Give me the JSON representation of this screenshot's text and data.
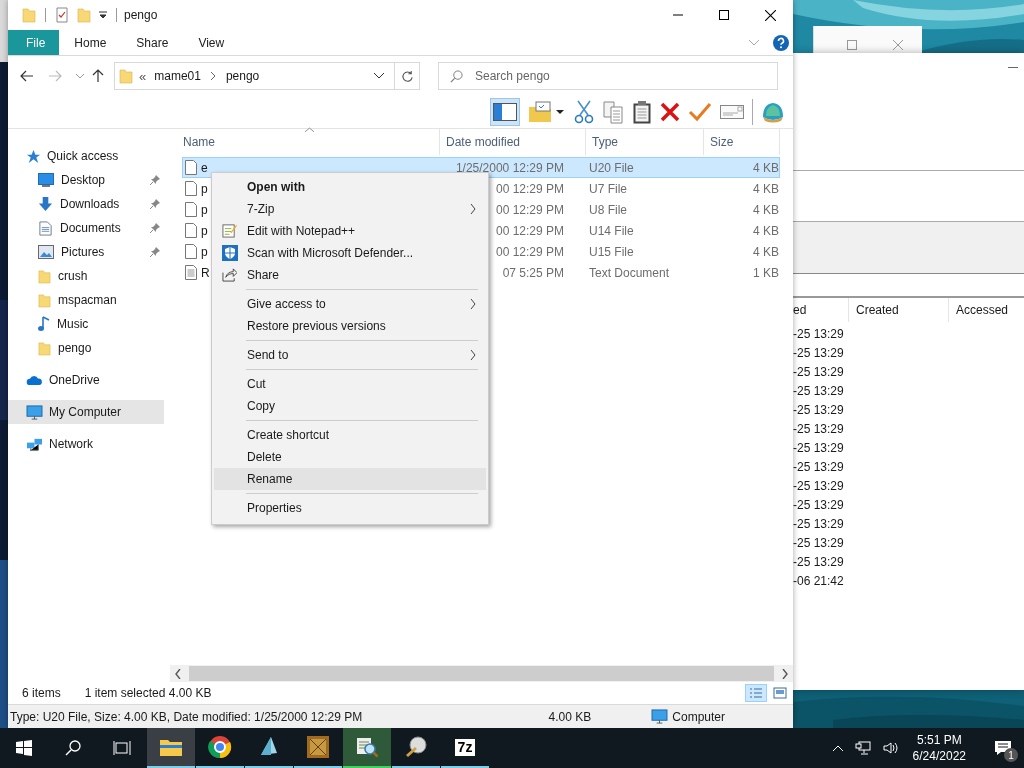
{
  "explorer": {
    "title": "pengo",
    "ribbon_tabs": [
      {
        "label": "File",
        "selected": true
      },
      {
        "label": "Home",
        "selected": false
      },
      {
        "label": "Share",
        "selected": false
      },
      {
        "label": "View",
        "selected": false
      }
    ],
    "address": {
      "overflow": "«",
      "segments": [
        "mame01",
        "pengo"
      ]
    },
    "search": {
      "placeholder": "Search pengo"
    },
    "layout_button": {
      "selected": true
    },
    "nav": [
      {
        "label": "Quick access",
        "selected": false,
        "children": [
          {
            "label": "Desktop",
            "pinned": true,
            "selected": false
          },
          {
            "label": "Downloads",
            "pinned": true,
            "selected": false
          },
          {
            "label": "Documents",
            "pinned": true,
            "selected": false
          },
          {
            "label": "Pictures",
            "pinned": true,
            "selected": false
          },
          {
            "label": "crush",
            "pinned": false,
            "selected": false
          },
          {
            "label": "mspacman",
            "pinned": false,
            "selected": false
          },
          {
            "label": "Music",
            "pinned": false,
            "selected": false
          },
          {
            "label": "pengo",
            "pinned": false,
            "selected": false
          }
        ]
      },
      {
        "label": "OneDrive",
        "selected": false
      },
      {
        "label": "My Computer",
        "selected": true
      },
      {
        "label": "Network",
        "selected": false
      }
    ],
    "columns": [
      "Name",
      "Date modified",
      "Type",
      "Size"
    ],
    "rows": [
      {
        "name": "e",
        "date": "1/25/2000 12:29 PM",
        "type": "U20 File",
        "size": "4 KB",
        "selected": true
      },
      {
        "name": "p",
        "date": "00 12:29 PM",
        "type": "U7 File",
        "size": "4 KB",
        "selected": false
      },
      {
        "name": "p",
        "date": "00 12:29 PM",
        "type": "U8 File",
        "size": "4 KB",
        "selected": false
      },
      {
        "name": "p",
        "date": "00 12:29 PM",
        "type": "U14 File",
        "size": "4 KB",
        "selected": false
      },
      {
        "name": "p",
        "date": "00 12:29 PM",
        "type": "U15 File",
        "size": "4 KB",
        "selected": false
      },
      {
        "name": "R",
        "date": "07 5:25 PM",
        "type": "Text Document",
        "size": "1 KB",
        "selected": false
      }
    ],
    "context_menu": [
      {
        "kind": "item",
        "label": "Open with",
        "bold": true,
        "submenu": false,
        "selected": false
      },
      {
        "kind": "item",
        "label": "7-Zip",
        "bold": false,
        "submenu": true,
        "selected": false
      },
      {
        "kind": "item",
        "label": "Edit with Notepad++",
        "bold": false,
        "submenu": false,
        "selected": false
      },
      {
        "kind": "item",
        "label": "Scan with Microsoft Defender...",
        "bold": false,
        "submenu": false,
        "selected": false
      },
      {
        "kind": "item",
        "label": "Share",
        "bold": false,
        "submenu": false,
        "selected": false
      },
      {
        "kind": "separator"
      },
      {
        "kind": "item",
        "label": "Give access to",
        "bold": false,
        "submenu": true,
        "selected": false
      },
      {
        "kind": "item",
        "label": "Restore previous versions",
        "bold": false,
        "submenu": false,
        "selected": false
      },
      {
        "kind": "separator"
      },
      {
        "kind": "item",
        "label": "Send to",
        "bold": false,
        "submenu": true,
        "selected": false
      },
      {
        "kind": "separator"
      },
      {
        "kind": "item",
        "label": "Cut",
        "bold": false,
        "submenu": false,
        "selected": false
      },
      {
        "kind": "item",
        "label": "Copy",
        "bold": false,
        "submenu": false,
        "selected": false
      },
      {
        "kind": "separator"
      },
      {
        "kind": "item",
        "label": "Create shortcut",
        "bold": false,
        "submenu": false,
        "selected": false
      },
      {
        "kind": "item",
        "label": "Delete",
        "bold": false,
        "submenu": false,
        "selected": false
      },
      {
        "kind": "item",
        "label": "Rename",
        "bold": false,
        "submenu": false,
        "selected": true
      },
      {
        "kind": "separator"
      },
      {
        "kind": "item",
        "label": "Properties",
        "bold": false,
        "submenu": false,
        "selected": false
      }
    ],
    "status": {
      "count": "6 items",
      "selection": "1 item selected  4.00 KB"
    },
    "view_buttons": [
      {
        "selected": true
      },
      {
        "selected": false
      }
    ],
    "details_bar": {
      "text": "Type: U20 File, Size: 4.00 KB, Date modified: 1/25/2000 12:29 PM",
      "size": "4.00 KB",
      "location": "Computer"
    }
  },
  "back_window": {
    "columns": [
      "ed",
      "Created",
      "Accessed"
    ],
    "rows": [
      "-25 13:29",
      "-25 13:29",
      "-25 13:29",
      "-25 13:29",
      "-25 13:29",
      "-25 13:29",
      "-25 13:29",
      "-25 13:29",
      "-25 13:29",
      "-25 13:29",
      "-25 13:29",
      "-25 13:29",
      "-25 13:29",
      "-06 21:42"
    ]
  },
  "taskbar": {
    "apps": [
      {
        "selected": true,
        "attention": false
      },
      {
        "selected": false,
        "attention": false
      },
      {
        "selected": false,
        "attention": false
      },
      {
        "selected": false,
        "attention": false
      },
      {
        "selected": false,
        "attention": true
      },
      {
        "selected": false,
        "attention": false
      },
      {
        "selected": false,
        "attention": false
      }
    ],
    "archiver_label": "7z",
    "time": "5:51 PM",
    "date": "6/24/2022",
    "notification_count": "1"
  }
}
